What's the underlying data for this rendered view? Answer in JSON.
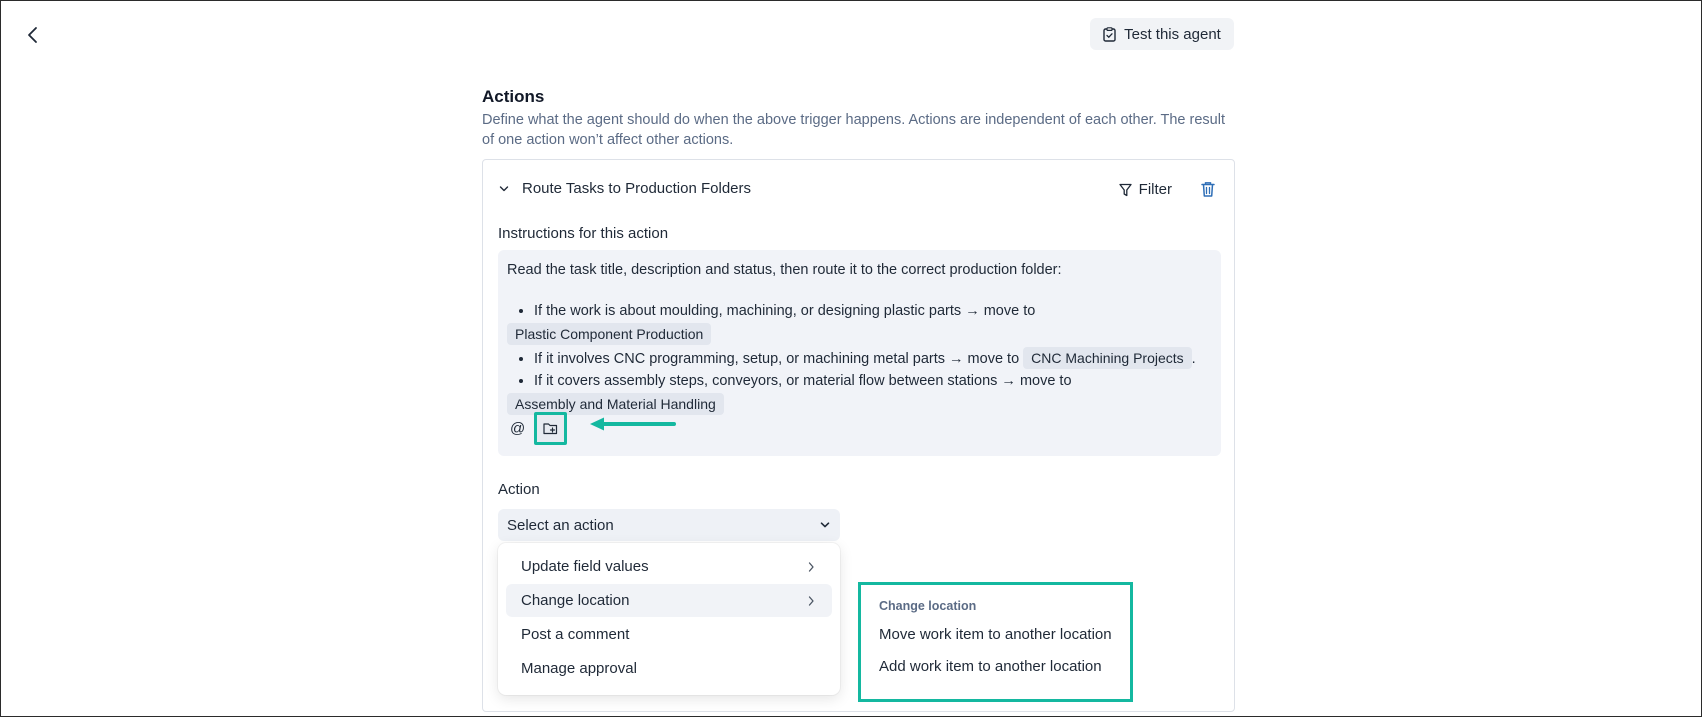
{
  "header": {
    "test_button_label": "Test this agent"
  },
  "section": {
    "title": "Actions",
    "description": "Define what the agent should do when the above trigger happens. Actions are independent of each other. The result of one action won’t affect other actions."
  },
  "action_card": {
    "name": "Route Tasks to Production Folders",
    "filter_label": "Filter",
    "instructions_label": "Instructions for this action",
    "instructions": {
      "intro": "Read the task title, description and status, then route it to the correct production folder:",
      "rules": [
        {
          "text": "If the work is about moulding, machining, or designing plastic parts → move to",
          "folder": "Plastic Component Production",
          "suffix": ""
        },
        {
          "text": "If it involves CNC programming, setup, or machining metal parts → move to",
          "folder": "CNC Machining Projects",
          "suffix": "."
        },
        {
          "text": "If it covers assembly steps, conveyors, or material flow between stations → move to",
          "folder": "Assembly and Material Handling",
          "suffix": ""
        }
      ]
    },
    "toolbar": {
      "mention_symbol": "@"
    },
    "action_label": "Action",
    "action_select_placeholder": "Select an action",
    "action_menu": [
      {
        "label": "Update field values",
        "has_submenu": true
      },
      {
        "label": "Change location",
        "has_submenu": true
      },
      {
        "label": "Post a comment",
        "has_submenu": false
      },
      {
        "label": "Manage approval",
        "has_submenu": false
      }
    ],
    "submenu": {
      "title": "Change location",
      "items": [
        "Move work item to another location",
        "Add work item to another location"
      ]
    }
  },
  "colors": {
    "annotation_accent": "#14b8a0",
    "muted_text": "#5b6b85",
    "trash_icon": "#2f6fb7"
  }
}
